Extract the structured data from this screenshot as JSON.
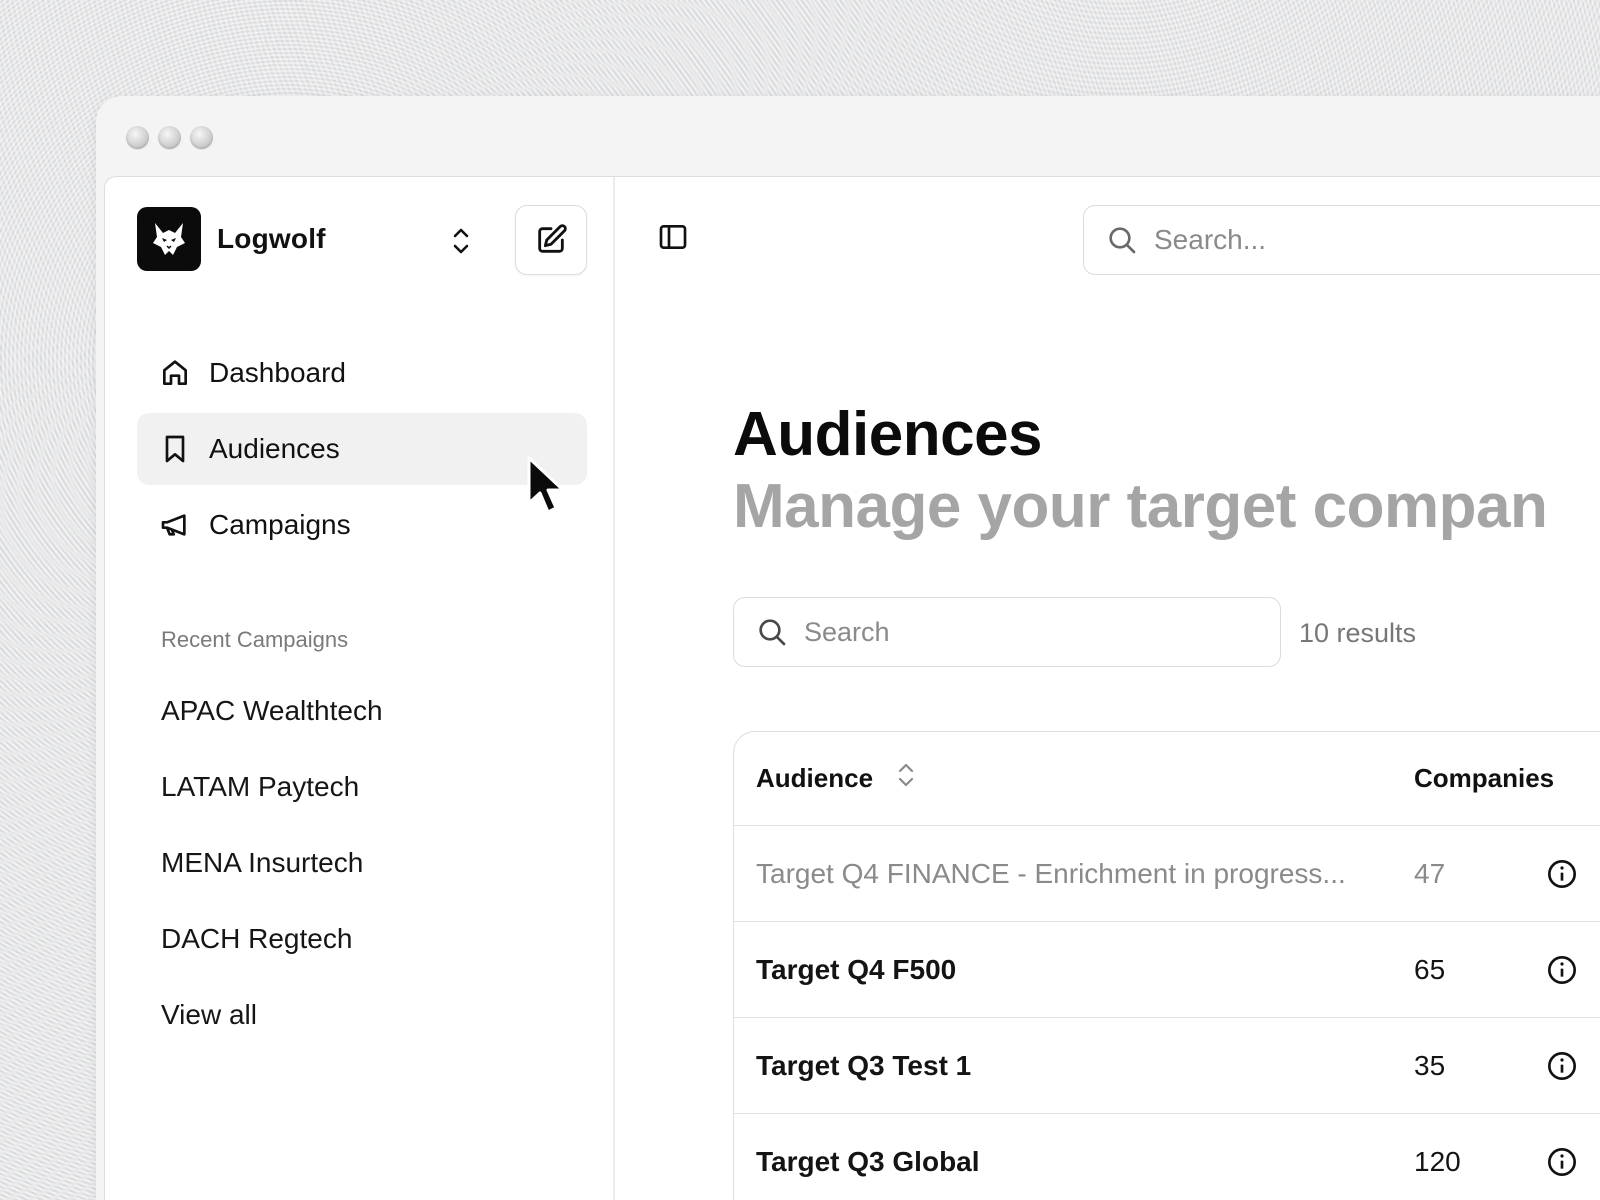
{
  "brand": {
    "name": "Logwolf"
  },
  "nav": [
    {
      "label": "Dashboard",
      "icon": "home-icon",
      "active": false
    },
    {
      "label": "Audiences",
      "icon": "bookmark-icon",
      "active": true
    },
    {
      "label": "Campaigns",
      "icon": "megaphone-icon",
      "active": false
    }
  ],
  "recent": {
    "title": "Recent Campaigns",
    "items": [
      "APAC Wealthtech",
      "LATAM Paytech",
      "MENA Insurtech",
      "DACH Regtech",
      "View all"
    ]
  },
  "top_search": {
    "placeholder": "Search..."
  },
  "page": {
    "title": "Audiences",
    "subtitle": "Manage your target compan"
  },
  "list_search": {
    "placeholder": "Search"
  },
  "results_text": "10 results",
  "table": {
    "columns": [
      "Audience",
      "Companies"
    ],
    "rows": [
      {
        "name": "Target Q4 FINANCE - Enrichment in progress...",
        "companies": "47",
        "muted": true
      },
      {
        "name": "Target Q4 F500",
        "companies": "65",
        "muted": false
      },
      {
        "name": "Target Q3 Test 1",
        "companies": "35",
        "muted": false
      },
      {
        "name": "Target Q3 Global",
        "companies": "120",
        "muted": false
      }
    ]
  },
  "colors": {
    "active_nav_bg": "#f1f1f1",
    "muted_text": "#8a8a8a",
    "subtitle": "#a5a5a5"
  }
}
